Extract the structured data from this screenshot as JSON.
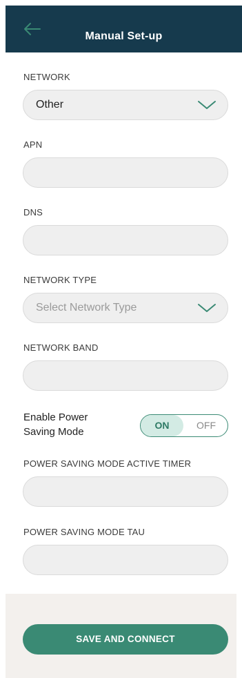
{
  "header": {
    "title": "Manual Set-up",
    "back_icon": "arrow-left-icon",
    "background": "#163a4d",
    "icon_color": "#3a8a74"
  },
  "network": {
    "label": "NETWORK",
    "selected": "Other"
  },
  "apn": {
    "label": "APN",
    "value": ""
  },
  "dns": {
    "label": "DNS",
    "value": ""
  },
  "network_type": {
    "label": "NETWORK TYPE",
    "placeholder": "Select Network Type"
  },
  "network_band": {
    "label": "NETWORK BAND",
    "value": ""
  },
  "power_saving": {
    "label_line1": "Enable Power",
    "label_line2": "Saving Mode",
    "on_label": "ON",
    "off_label": "OFF",
    "state": "on"
  },
  "psm_active_timer": {
    "label": "POWER SAVING MODE ACTIVE TIMER",
    "value": ""
  },
  "psm_tau": {
    "label": "POWER SAVING MODE TAU",
    "value": ""
  },
  "footer": {
    "save_label": "SAVE AND CONNECT"
  },
  "colors": {
    "accent": "#3a8a74",
    "field_bg": "#efefef",
    "footer_bg": "#f3f0ed"
  }
}
